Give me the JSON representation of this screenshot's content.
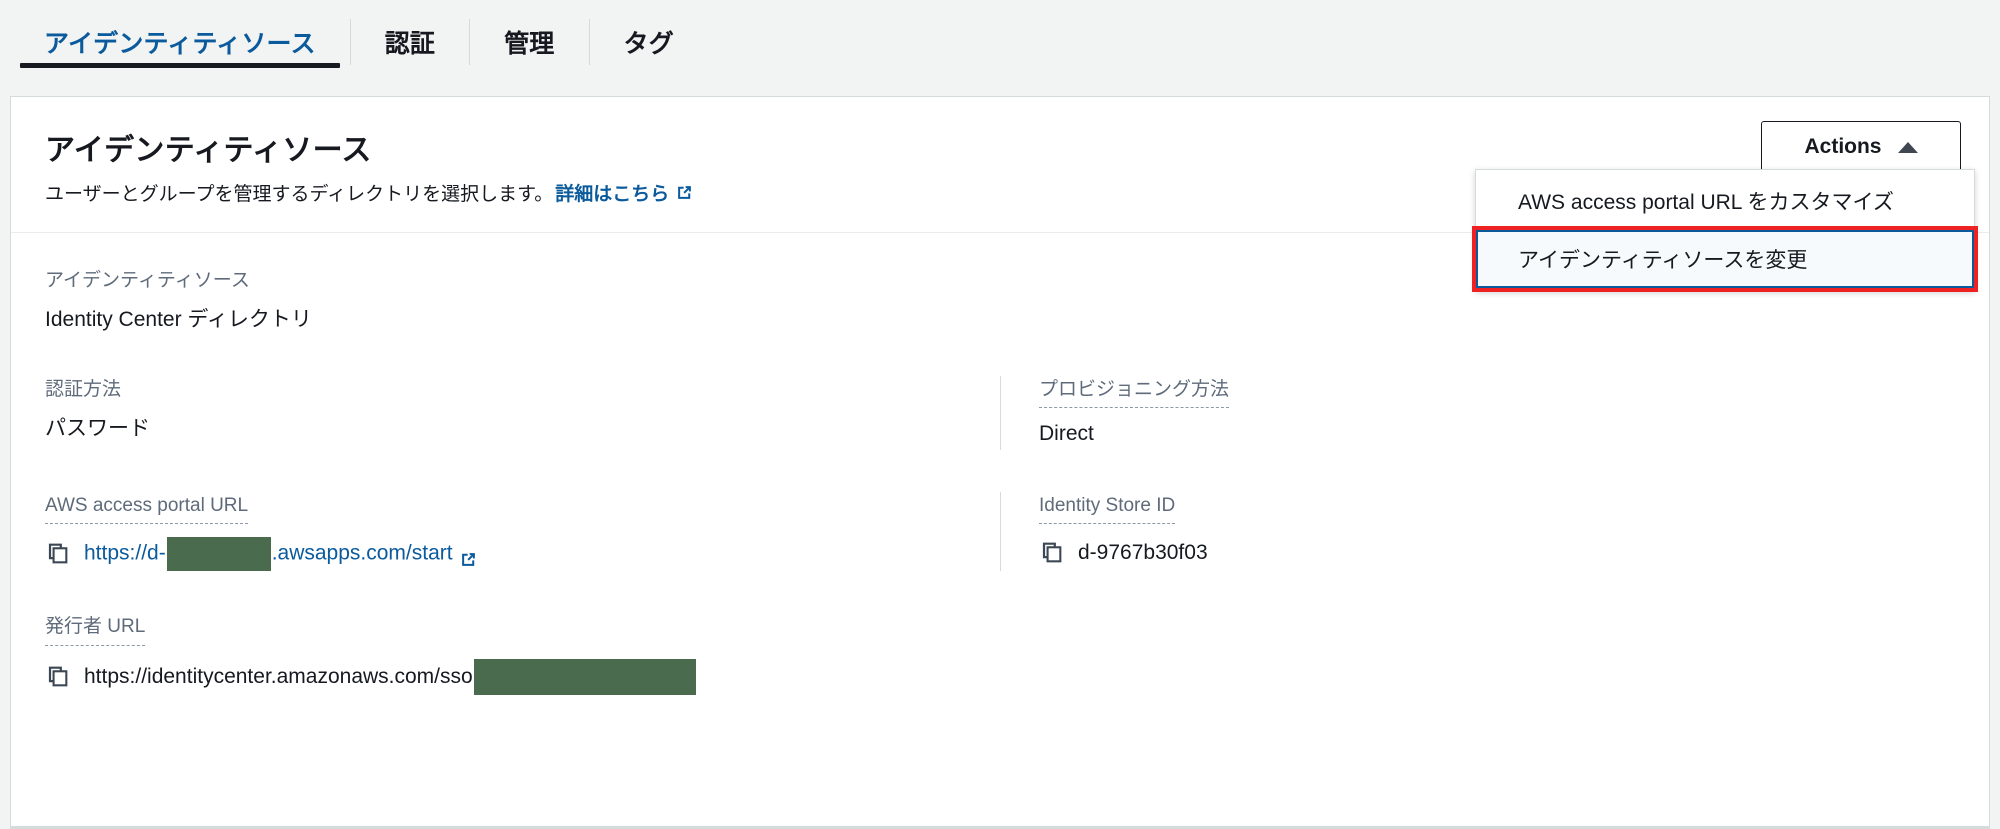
{
  "tabs": [
    {
      "label": "アイデンティティソース",
      "active": true
    },
    {
      "label": "認証",
      "active": false
    },
    {
      "label": "管理",
      "active": false
    },
    {
      "label": "タグ",
      "active": false
    }
  ],
  "header": {
    "title": "アイデンティティソース",
    "description": "ユーザーとグループを管理するディレクトリを選択します。",
    "more_link": "詳細はこちら",
    "external_icon": "external-link-icon"
  },
  "actions": {
    "label": "Actions",
    "caret_icon": "caret-up-icon",
    "expanded": true,
    "menu_items": [
      {
        "label": "AWS access portal URL をカスタマイズ",
        "highlighted": false
      },
      {
        "label": "アイデンティティソースを変更",
        "highlighted": true
      }
    ]
  },
  "details": {
    "identity_source": {
      "label": "アイデンティティソース",
      "value": "Identity Center ディレクトリ"
    },
    "auth_method": {
      "label": "認証方法",
      "value": "パスワード"
    },
    "provisioning_method": {
      "label": "プロビジョニング方法",
      "value": "Direct"
    },
    "access_portal_url": {
      "label": "AWS access portal URL",
      "value_prefix": "https://d-",
      "value_suffix": ".awsapps.com/start",
      "redacted": true,
      "copy_icon": "copy-icon",
      "external_icon": "external-link-icon"
    },
    "identity_store_id": {
      "label": "Identity Store ID",
      "value": "d-9767b30f03",
      "copy_icon": "copy-icon"
    },
    "issuer_url": {
      "label": "発行者 URL",
      "value_prefix": "https://identitycenter.amazonaws.com/sso",
      "redacted": true,
      "copy_icon": "copy-icon"
    }
  },
  "colors": {
    "accent_blue": "#0a5a9c",
    "text_dark": "#16191f",
    "label_gray": "#5f6b7a",
    "border_gray": "#d5dbdb",
    "page_bg": "#f2f3f3",
    "highlight_red": "#ee2222",
    "redaction_green": "#4a6b4e"
  }
}
